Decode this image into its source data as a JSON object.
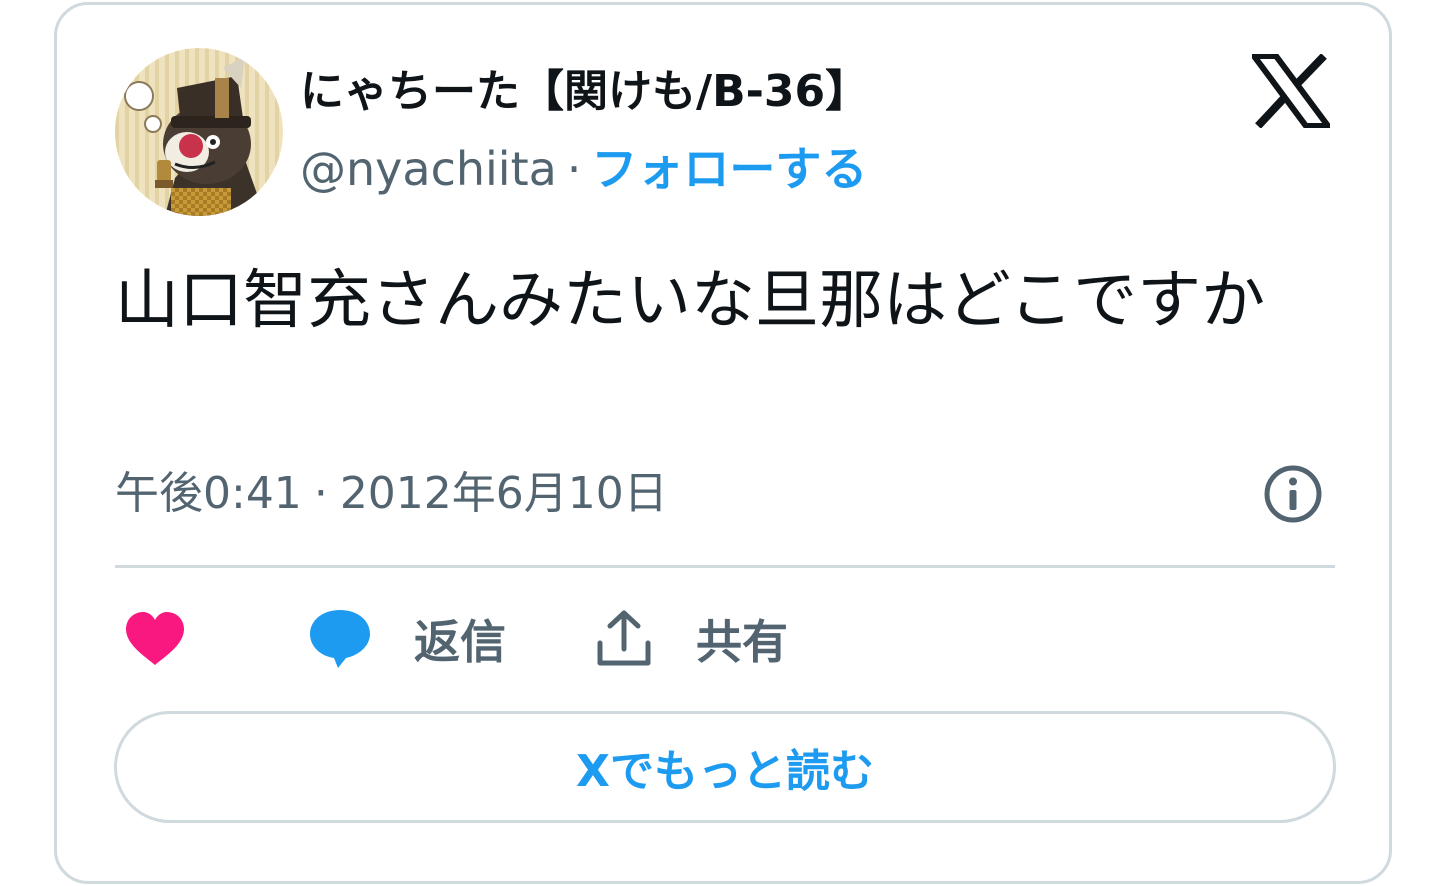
{
  "author": {
    "display_name": "にゃちーた【関けも/B-36】",
    "handle": "@nyachiita",
    "separator": "·",
    "follow_label": "フォローする"
  },
  "tweet": {
    "text": "山口智充さんみたいな旦那はどこですか",
    "time": "午後0:41",
    "separator": "·",
    "date": "2012年6月10日"
  },
  "actions": {
    "reply_label": "返信",
    "share_label": "共有"
  },
  "read_more_label": "Xでもっと読む",
  "icons": {
    "logo": "x-logo-icon",
    "info": "info-icon",
    "like": "heart-icon",
    "reply": "speech-bubble-icon",
    "share": "share-upload-icon"
  },
  "colors": {
    "accent": "#1d9bf0",
    "like": "#f91880",
    "text": "#0f1419",
    "secondary": "#536471",
    "border": "#cfd9de"
  }
}
